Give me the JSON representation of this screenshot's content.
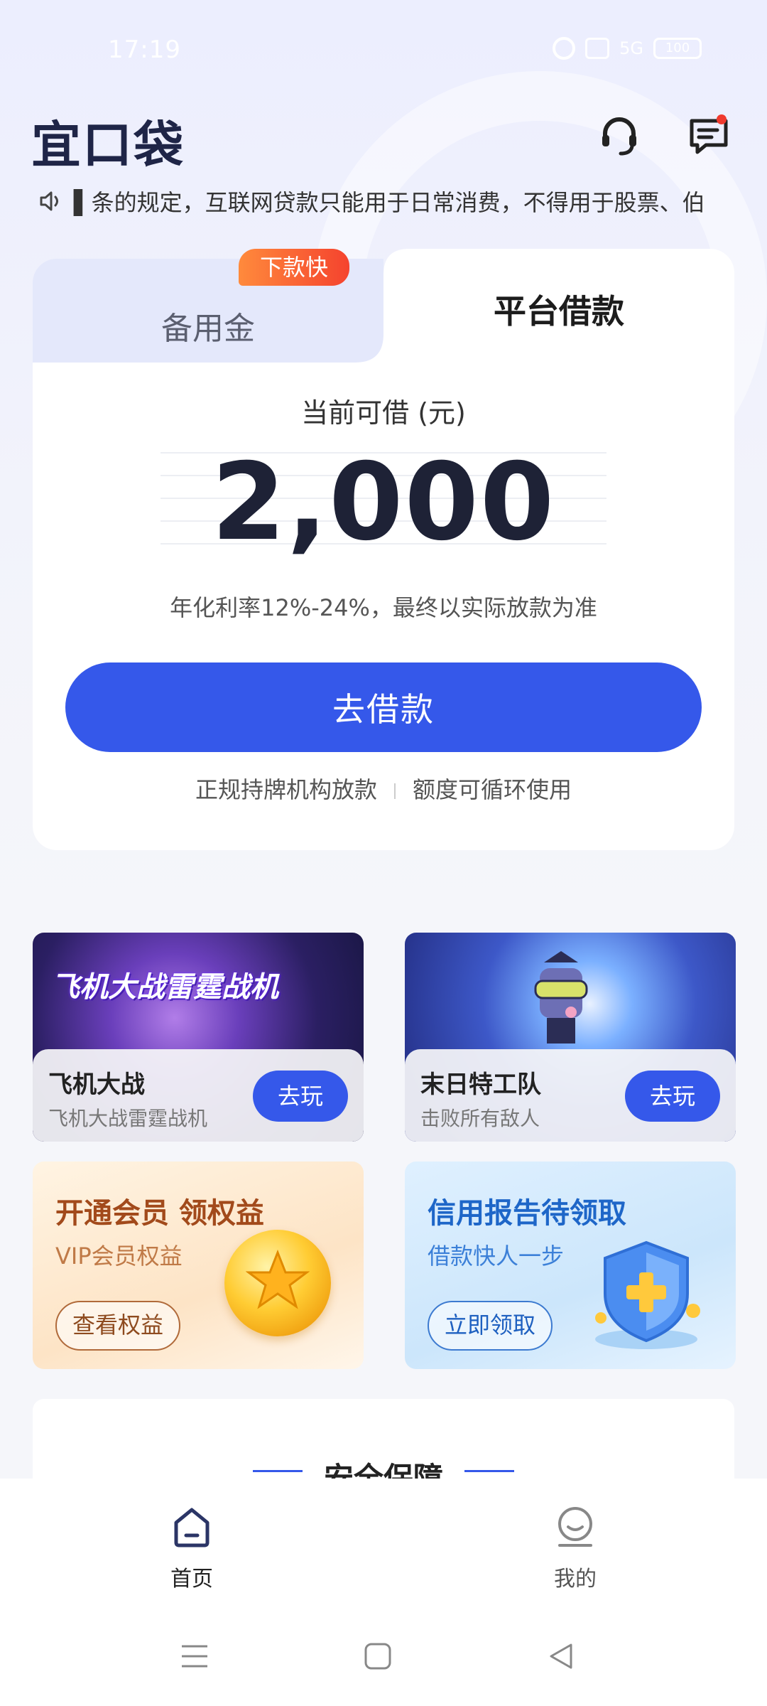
{
  "status_bar": {
    "time": "17:19",
    "network": "5G",
    "battery": "100"
  },
  "header": {
    "logo": "宜口袋",
    "support_icon": "headset-icon",
    "message_icon": "message-icon"
  },
  "notice": {
    "text": "▌条的规定，互联网贷款只能用于日常消费，不得用于股票、伯"
  },
  "loan_card": {
    "tab_left": "备用金",
    "tab_left_badge": "下款快",
    "tab_right": "平台借款",
    "available_label": "当前可借 (元)",
    "amount": "2,000",
    "rate_text": "年化利率12%-24%，最终以实际放款为准",
    "button_label": "去借款",
    "feature_1": "正规持牌机构放款",
    "feature_2": "额度可循环使用"
  },
  "games": [
    {
      "banner": "飞机大战雷霆战机",
      "title": "飞机大战",
      "subtitle": "飞机大战雷霆战机",
      "button": "去玩"
    },
    {
      "title": "末日特工队",
      "subtitle": "击败所有敌人",
      "button": "去玩"
    }
  ],
  "promos": [
    {
      "title": "开通会员 领权益",
      "subtitle": "VIP会员权益",
      "button": "查看权益"
    },
    {
      "title": "信用报告待领取",
      "subtitle": "借款快人一步",
      "button": "立即领取"
    }
  ],
  "security": {
    "title": "安全保障"
  },
  "bottom_nav": {
    "home": "首页",
    "mine": "我的"
  },
  "colors": {
    "primary": "#3558ea",
    "badge": "#f5432e",
    "logo": "#1f2547"
  }
}
